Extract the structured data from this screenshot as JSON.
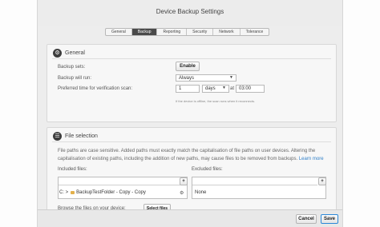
{
  "window": {
    "title": "Device Backup Settings"
  },
  "tabs": [
    {
      "label": "General",
      "active": false
    },
    {
      "label": "Backup",
      "active": true
    },
    {
      "label": "Reporting",
      "active": false
    },
    {
      "label": "Security",
      "active": false
    },
    {
      "label": "Network",
      "active": false
    },
    {
      "label": "Tolerance",
      "active": false
    }
  ],
  "general": {
    "title": "General",
    "icon": "gear-icon",
    "backup_sets_label": "Backup sets:",
    "backup_sets_button": "Enable",
    "backup_will_run_label": "Backup will run:",
    "backup_will_run_value": "Always",
    "verification_label": "Preferred time for verification scan:",
    "verification_count": "1",
    "verification_unit": "days",
    "verification_at": "at",
    "verification_time": "03:00",
    "offline_hint": "If the device is offline, the scan runs when it reconnects."
  },
  "files": {
    "title": "File selection",
    "icon": "list-icon",
    "description": "File paths are case sensitive. Added paths must exactly match the capitalisation of file paths on user devices. Altering the capitalisation of existing paths, including the addition of new paths, may cause files to be removed from backups.",
    "learn_more": "Learn more",
    "included_label": "Included files:",
    "excluded_label": "Excluded files:",
    "add_symbol": "+",
    "included_item_prefix": "C: >",
    "included_item": "BackupTestFolder - Copy - Copy",
    "excluded_item": "None",
    "browse_label": "Browse the files on your device:",
    "select_files_button": "Select files"
  },
  "footer": {
    "cancel_label": "Cancel",
    "save_label": "Save"
  },
  "colors": {
    "accent": "#2b88d8",
    "tab_active": "#4a4a4a",
    "link": "#2f7fc8"
  }
}
